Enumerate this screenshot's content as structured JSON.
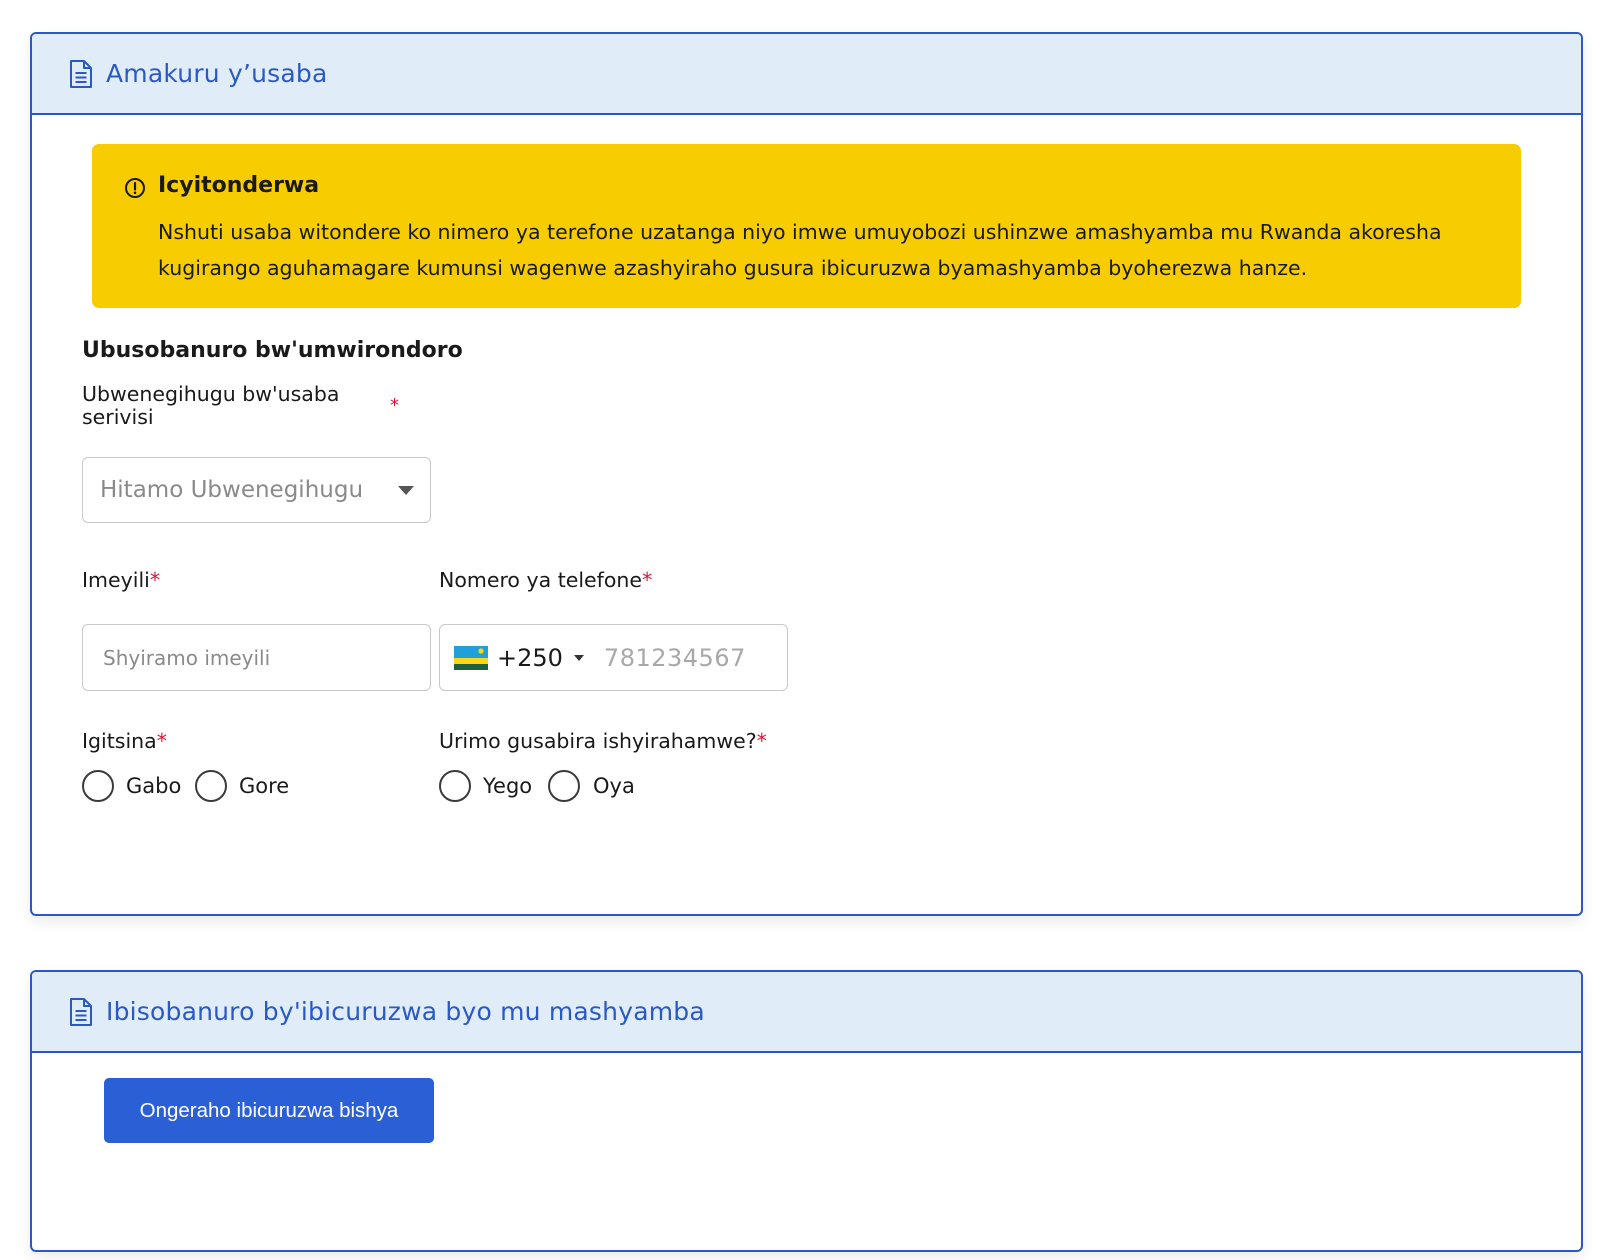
{
  "applicant_info": {
    "title": "Amakuru y’usaba",
    "notice": {
      "title": "Icyitonderwa",
      "text": "Nshuti usaba witondere ko nimero ya terefone uzatanga niyo imwe umuyobozi ushinzwe amashyamba mu Rwanda akoresha kugirango aguhamagare kumunsi wagenwe azashyiraho gusura ibicuruzwa byamashyamba byoherezwa hanze."
    },
    "section_title": "Ubusobanuro bw'umwirondoro",
    "nationality": {
      "label": "Ubwenegihugu bw'usaba serivisi",
      "required_mark": "*",
      "placeholder": "Hitamo Ubwenegihugu"
    },
    "email": {
      "label": "Imeyili",
      "required_mark": "*",
      "placeholder": "Shyiramo imeyili"
    },
    "phone": {
      "label": "Nomero ya telefone",
      "required_mark": "*",
      "country_code": "+250",
      "placeholder": "781234567",
      "flag": "rwanda-flag-icon"
    },
    "gender": {
      "label": "Igitsina",
      "required_mark": "*",
      "options": [
        "Gabo",
        "Gore"
      ]
    },
    "group_request": {
      "label": "Urimo gusabira ishyirahamwe?",
      "required_mark": "*",
      "options": [
        "Yego",
        "Oya"
      ]
    }
  },
  "products": {
    "title": "Ibisobanuro by'ibicuruzwa byo mu mashyamba",
    "add_button_label": "Ongeraho ibicuruzwa bishya"
  },
  "colors": {
    "accent": "#2b59c3",
    "header_bg": "#e1ecf9",
    "notice_bg": "#f7cc00",
    "required": "#e0123b",
    "button_bg": "#2b5fd6"
  }
}
